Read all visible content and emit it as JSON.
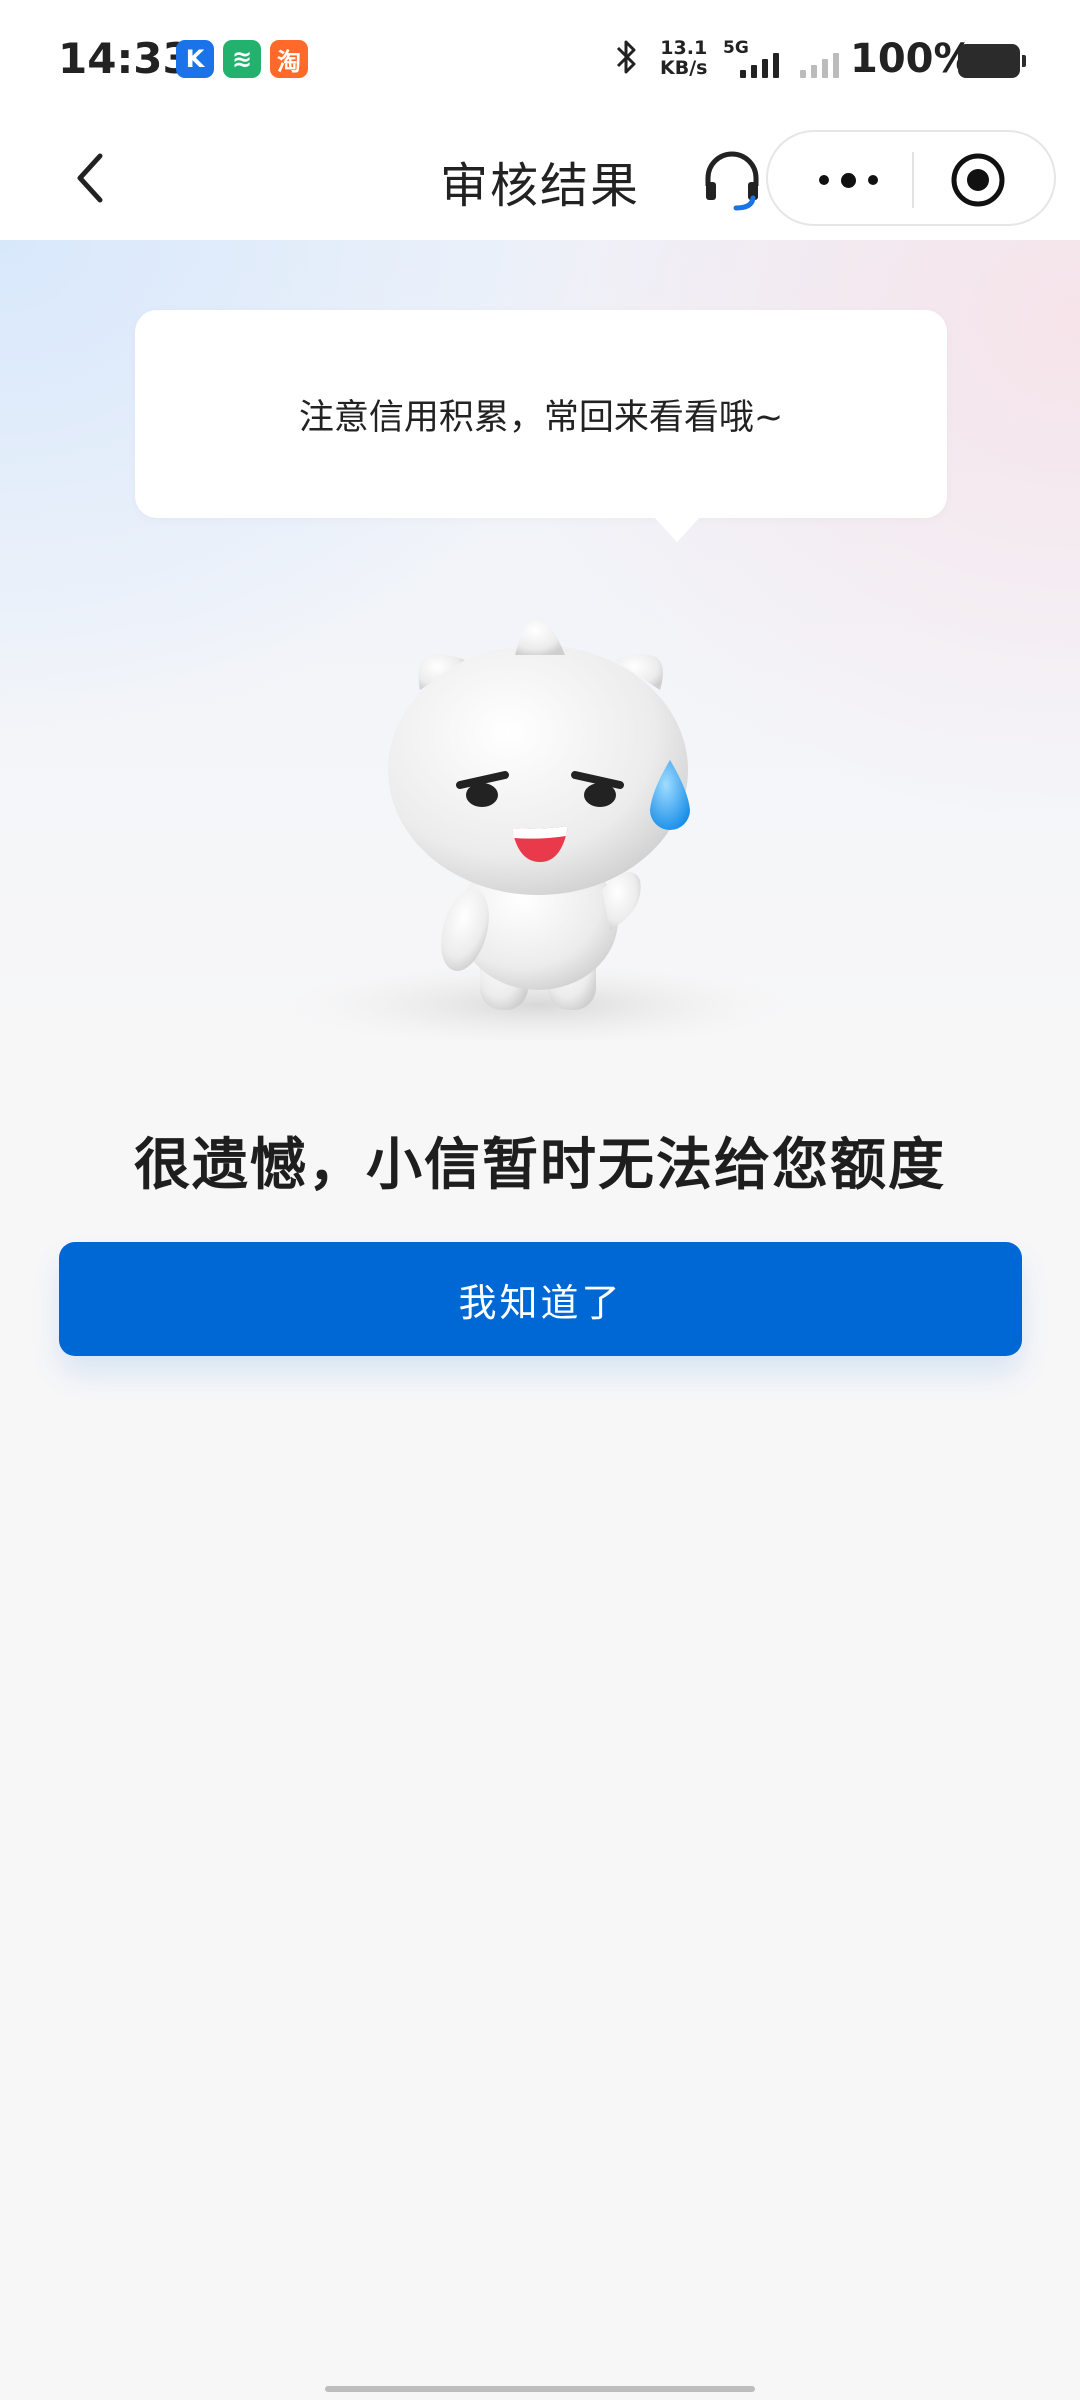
{
  "status_bar": {
    "time": "14:33",
    "app_badges": [
      {
        "icon": "k-app-icon",
        "glyph": "K"
      },
      {
        "icon": "wifi-key-app-icon",
        "glyph": "≋"
      },
      {
        "icon": "taobao-app-icon",
        "glyph": "淘"
      }
    ],
    "net_speed_value": "13.1",
    "net_speed_unit": "KB/s",
    "network_type": "5G",
    "battery": "100%"
  },
  "nav": {
    "title": "审核结果",
    "back_icon": "chevron-left-icon",
    "service_icon": "headset-icon",
    "more_icon": "more-dots-icon",
    "close_icon": "target-circle-icon"
  },
  "hero": {
    "bubble_text": "注意信用积累，常回来看看哦~",
    "mascot": "white-cat-mascot-sweat-drop"
  },
  "result": {
    "title": "很遗憾，小信暂时无法给您额度",
    "button_label": "我知道了"
  },
  "colors": {
    "primary": "#0068d4",
    "background": "#f7f7f8",
    "sweat_drop": "#2aa4f4"
  }
}
